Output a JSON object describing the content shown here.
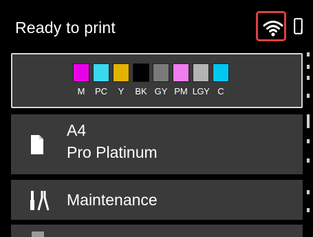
{
  "header": {
    "status": "Ready to print",
    "wifi_icon": "wifi-icon",
    "device_icon": "device-icon"
  },
  "inks": [
    {
      "label": "M",
      "color": "#e800e8"
    },
    {
      "label": "PC",
      "color": "#3ad8f0"
    },
    {
      "label": "Y",
      "color": "#e2b400"
    },
    {
      "label": "BK",
      "color": "#000000"
    },
    {
      "label": "GY",
      "color": "#7a7a7a"
    },
    {
      "label": "PM",
      "color": "#f07cf0"
    },
    {
      "label": "LGY",
      "color": "#b4b4b4"
    },
    {
      "label": "C",
      "color": "#00c8f0"
    }
  ],
  "paper": {
    "size": "A4",
    "type": "Pro Platinum",
    "icon": "paper-icon"
  },
  "maintenance": {
    "label": "Maintenance",
    "icon": "maintenance-icon"
  },
  "colors": {
    "highlight": "#e0413a",
    "panel": "#3a3a3a",
    "background": "#000000"
  }
}
